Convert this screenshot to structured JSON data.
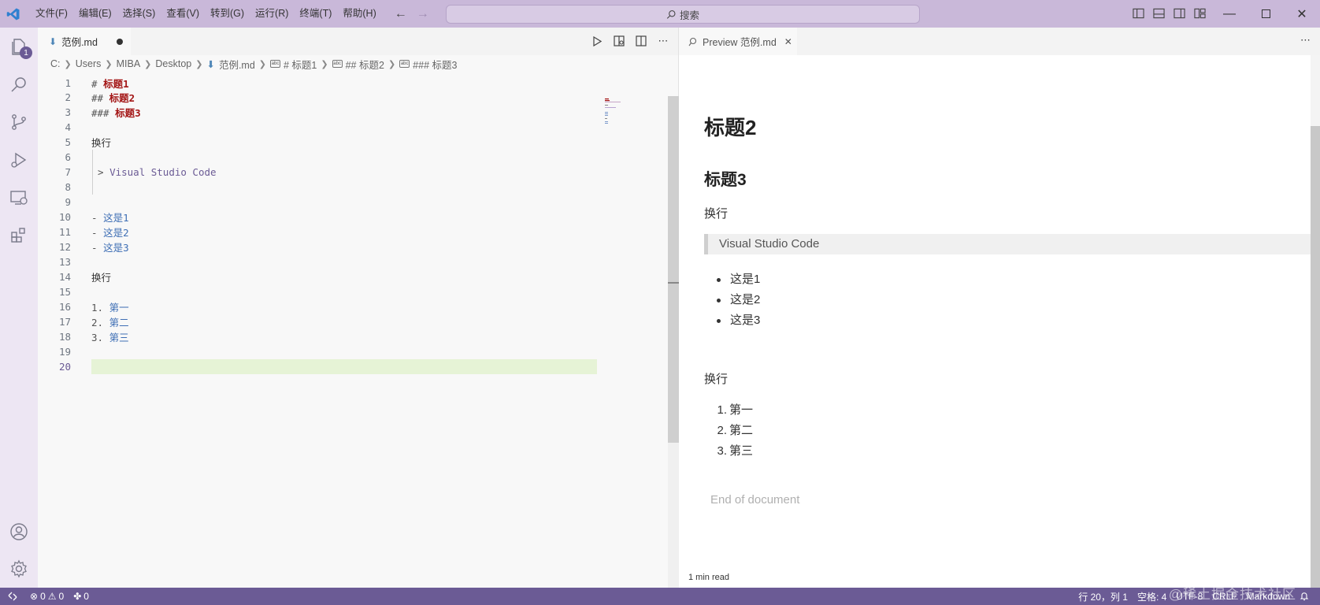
{
  "menu": {
    "items": [
      "文件(F)",
      "编辑(E)",
      "选择(S)",
      "查看(V)",
      "转到(G)",
      "运行(R)",
      "终端(T)",
      "帮助(H)"
    ]
  },
  "search": {
    "label": "搜索"
  },
  "activity": {
    "explorer_badge": "1"
  },
  "editor": {
    "tab_title": "范例.md",
    "breadcrumb": {
      "drive": "C:",
      "users": "Users",
      "user": "MIBA",
      "desktop": "Desktop",
      "file": "范例.md",
      "sym1": "# 标题1",
      "sym2": "## 标题2",
      "sym3": "### 标题3"
    },
    "lines": [
      {
        "n": "1",
        "mark": "# ",
        "text": "标题1"
      },
      {
        "n": "2",
        "mark": "## ",
        "text": "标题2"
      },
      {
        "n": "3",
        "mark": "### ",
        "text": "标题3"
      },
      {
        "n": "4"
      },
      {
        "n": "5",
        "plain": "换行"
      },
      {
        "n": "6"
      },
      {
        "n": "7",
        "quote_mark": "> ",
        "quote": "Visual Studio Code"
      },
      {
        "n": "8"
      },
      {
        "n": "9"
      },
      {
        "n": "10",
        "lmark": "- ",
        "ltext": "这是1"
      },
      {
        "n": "11",
        "lmark": "- ",
        "ltext": "这是2"
      },
      {
        "n": "12",
        "lmark": "- ",
        "ltext": "这是3"
      },
      {
        "n": "13"
      },
      {
        "n": "14",
        "plain": "换行"
      },
      {
        "n": "15"
      },
      {
        "n": "16",
        "lmark": "1. ",
        "ltext": "第一"
      },
      {
        "n": "17",
        "lmark": "2. ",
        "ltext": "第二"
      },
      {
        "n": "18",
        "lmark": "3. ",
        "ltext": "第三"
      },
      {
        "n": "19"
      },
      {
        "n": "20"
      }
    ]
  },
  "preview": {
    "tab_title": "Preview 范例.md",
    "h2": "标题2",
    "h3": "标题3",
    "para1": "换行",
    "quote": "Visual Studio Code",
    "ul": [
      "这是1",
      "这是2",
      "这是3"
    ],
    "para2": "换行",
    "ol": [
      {
        "num": "1.",
        "text": "第一"
      },
      {
        "num": "2.",
        "text": "第二"
      },
      {
        "num": "3.",
        "text": "第三"
      }
    ],
    "end": "End of document",
    "read_time": "1 min read"
  },
  "status": {
    "errors": "0",
    "warnings": "0",
    "ports": "0",
    "position": "行 20，列 1",
    "spaces": "空格: 4",
    "encoding": "UTF-8",
    "eol": "CRLF",
    "language": "Markdown",
    "watermark": "@稀土掘金技术社区"
  },
  "colors": {
    "accent": "#6b5b95",
    "titlebar": "#c9b8d9",
    "activitybar": "#ede6f3",
    "heading_red": "#a31515",
    "list_blue": "#3f6fb5"
  }
}
